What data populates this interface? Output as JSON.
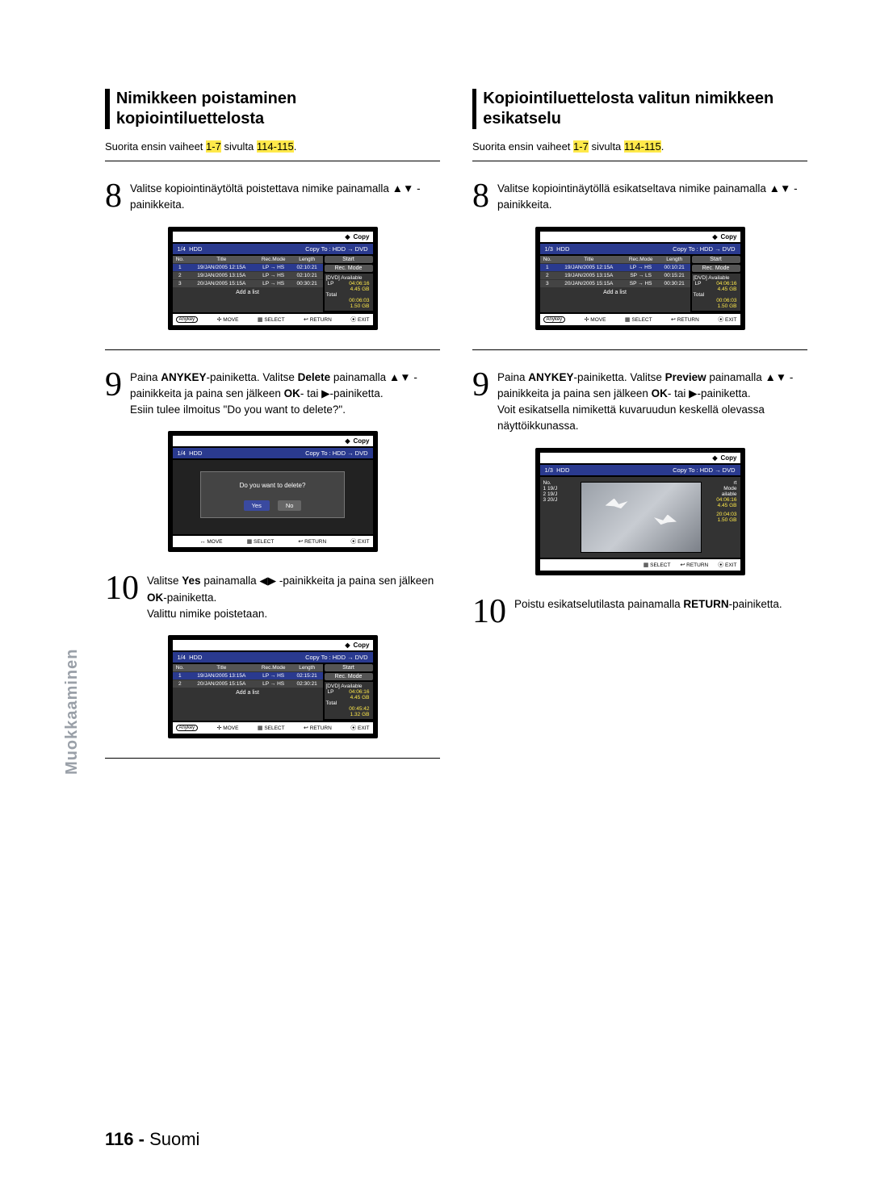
{
  "sideTab": "Muokkaaminen",
  "footer": {
    "pageNum": "116 -",
    "lang": "Suomi"
  },
  "common": {
    "copyLabel": "Copy",
    "copyTo": "Copy To : HDD → DVD",
    "hddLabel": "HDD",
    "cols": {
      "no": "No.",
      "title": "Title",
      "rec": "Rec.Mode",
      "len": "Length"
    },
    "addList": "Add a list",
    "start": "Start",
    "recMode": "Rec. Mode",
    "dvdAvail": "[DVD] Available",
    "total": "Total",
    "lp": "LP",
    "footerBtns": {
      "anykey": "Anykey",
      "move": "MOVE",
      "select": "SELECT",
      "return": "RETURN",
      "exit": "EXIT"
    }
  },
  "left": {
    "title": "Nimikkeen poistaminen kopiointiluettelosta",
    "pre": {
      "a": "Suorita ensin vaiheet ",
      "b": "1-7",
      "c": " sivulta ",
      "d": "114-115",
      "e": "."
    },
    "s8": {
      "num": "8",
      "txt": "Valitse kopiointinäytöltä poistettava nimike painamalla ▲▼ -painikkeita."
    },
    "scr1": {
      "rowNo": "1/4",
      "rows": [
        {
          "no": "1",
          "title": "19/JAN/2005 12:15A",
          "rec": "LP → HS",
          "len": "02:10:21",
          "hl": true
        },
        {
          "no": "2",
          "title": "19/JAN/2005 13:15A",
          "rec": "LP → HS",
          "len": "02:10:21"
        },
        {
          "no": "3",
          "title": "20/JAN/2005 15:15A",
          "rec": "LP → HS",
          "len": "00:30:21"
        }
      ],
      "info": {
        "lpTime": "04:06:16",
        "lpGB": "4.45 GB",
        "totTime": "00:06:03",
        "totGB": "1.50 GB"
      }
    },
    "s9": {
      "num": "9",
      "txt": "Paina <b>ANYKEY</b>-painiketta. Valitse <b>Delete</b> painamalla ▲▼ -painikkeita ja paina sen jälkeen <b>OK</b>- tai ▶-painiketta.<br>Esiin tulee ilmoitus \"Do you want to delete?\"."
    },
    "scr2": {
      "rowNo": "1/4",
      "question": "Do you want to delete?",
      "yes": "Yes",
      "no": "No"
    },
    "s10": {
      "num": "10",
      "txt": "Valitse <b>Yes</b> painamalla ◀▶ -painikkeita ja paina sen jälkeen <b>OK</b>-painiketta.<br>Valittu nimike poistetaan."
    },
    "scr3": {
      "rowNo": "1/4",
      "rows": [
        {
          "no": "1",
          "title": "19/JAN/2005 13:15A",
          "rec": "LP → HS",
          "len": "02:15:21",
          "hl": true
        },
        {
          "no": "2",
          "title": "20/JAN/2005 15:15A",
          "rec": "LP → HS",
          "len": "02:30:21"
        }
      ],
      "info": {
        "lpTime": "04:06:16",
        "lpGB": "4.45 GB",
        "totTime": "00:45:42",
        "totGB": "1.32 GB"
      }
    }
  },
  "right": {
    "title": "Kopiointiluettelosta valitun nimikkeen esikatselu",
    "pre": {
      "a": "Suorita ensin vaiheet ",
      "b": "1-7",
      "c": " sivulta ",
      "d": "114-115",
      "e": "."
    },
    "s8": {
      "num": "8",
      "txt": "Valitse kopiointinäytöllä esikatseltava nimike painamalla ▲▼ -painikkeita."
    },
    "scr1": {
      "rowNo": "1/3",
      "rows": [
        {
          "no": "1",
          "title": "19/JAN/2005 12:15A",
          "rec": "LP → HS",
          "len": "00:10:21",
          "hl": true
        },
        {
          "no": "2",
          "title": "19/JAN/2005 13:15A",
          "rec": "SP → LS",
          "len": "00:15:21"
        },
        {
          "no": "3",
          "title": "20/JAN/2005 15:15A",
          "rec": "SP → HS",
          "len": "00:30:21"
        }
      ],
      "info": {
        "lpTime": "04:06:16",
        "lpGB": "4.45 GB",
        "totTime": "00:06:03",
        "totGB": "1.50 GB"
      }
    },
    "s9": {
      "num": "9",
      "txt": "Paina <b>ANYKEY</b>-painiketta. Valitse <b>Preview</b> painamalla ▲▼ -painikkeita ja paina sen jälkeen <b>OK</b>- tai ▶-painiketta.<br>Voit esikatsella nimikettä kuvaruudun keskellä olevassa näyttöikkunassa."
    },
    "scr2": {
      "rowNo": "1/3",
      "rows": [
        {
          "no": "1",
          "title": "19/J"
        },
        {
          "no": "2",
          "title": "19/J"
        },
        {
          "no": "3",
          "title": "20/J"
        }
      ],
      "info": {
        "lpTime": "04:06:16",
        "lpGB": "4.45 GB",
        "totTime": "20:04:03",
        "totGB": "1.50 GB"
      },
      "sidebits": {
        "rt": "rt",
        "mode": "Mode",
        "avail": "ailable"
      }
    },
    "s10": {
      "num": "10",
      "txt": "Poistu esikatselutilasta painamalla <b>RETURN</b>-painiketta."
    }
  }
}
